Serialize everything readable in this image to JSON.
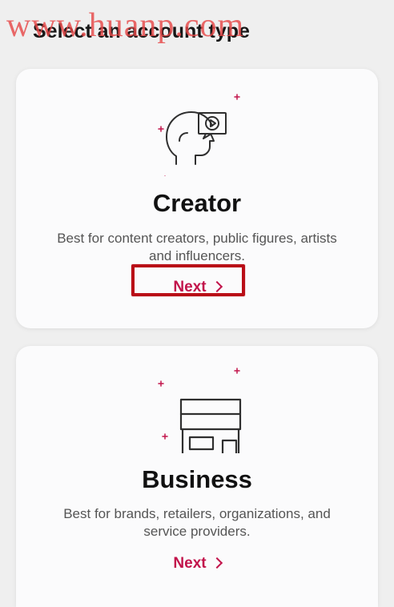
{
  "watermark": "www.huanp.com",
  "title": "Select an account type",
  "cards": [
    {
      "title": "Creator",
      "description": "Best for content creators, public figures, artists and influencers.",
      "next_label": "Next",
      "icon": "creator-icon"
    },
    {
      "title": "Business",
      "description": "Best for brands, retailers, organizations, and service providers.",
      "next_label": "Next",
      "icon": "business-store-icon"
    }
  ],
  "colors": {
    "accent": "#c2144b",
    "highlight": "#b90e17",
    "watermark": "#e64848"
  }
}
